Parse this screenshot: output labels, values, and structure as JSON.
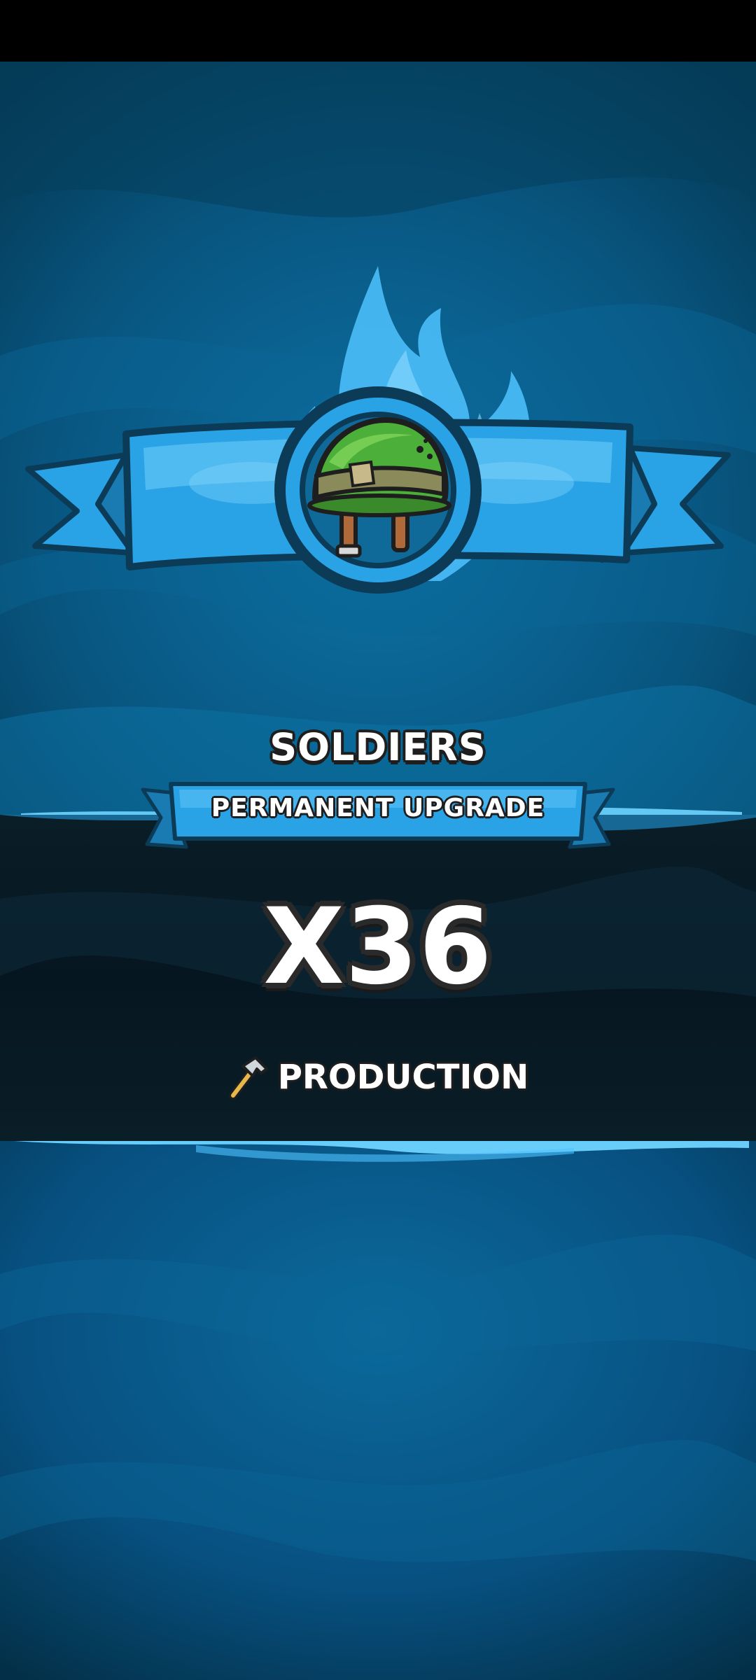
{
  "reward": {
    "title": "SOLDIERS",
    "subtitle": "PERMANENT UPGRADE",
    "multiplier": "X36",
    "stat_label": "PRODUCTION",
    "stat_icon": "hammer-icon",
    "item_icon": "army-helmet-icon"
  },
  "colors": {
    "background_blue": "#0b5d88",
    "ribbon_blue": "#2aa3e6",
    "flame_blue": "#4fc3ff",
    "dark_band": "#0a1e28",
    "helmet_green": "#4caf3a"
  }
}
